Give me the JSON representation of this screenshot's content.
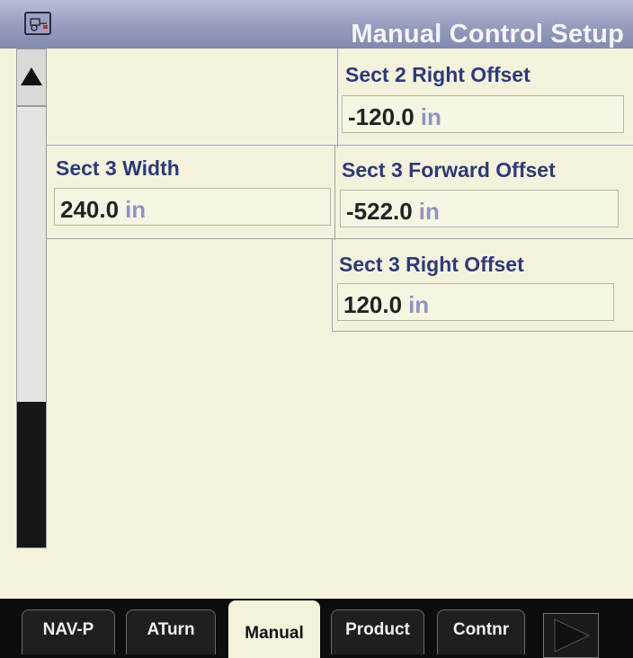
{
  "title_bar": {
    "title": "Manual Control Setup",
    "app_icon": "implement-icon"
  },
  "scrollbar": {
    "up_icon": "triangle-up-icon"
  },
  "fields": {
    "sect2_right_offset": {
      "label": "Sect 2 Right Offset",
      "value": "-120.0",
      "unit": "in"
    },
    "sect3_width": {
      "label": "Sect 3 Width",
      "value": "240.0",
      "unit": "in"
    },
    "sect3_forward_offset": {
      "label": "Sect 3 Forward Offset",
      "value": "-522.0",
      "unit": "in"
    },
    "sect3_right_offset": {
      "label": "Sect 3 Right Offset",
      "value": "120.0",
      "unit": "in"
    }
  },
  "tabs": [
    {
      "label": "NAV-P"
    },
    {
      "label": "ATurn"
    },
    {
      "label": "Manual",
      "active": true
    },
    {
      "label": "Product"
    },
    {
      "label": "Contnr"
    }
  ],
  "next_icon": "triangle-right-icon",
  "colors": {
    "title_bar": "#8f96b9",
    "background": "#f4f2dc",
    "label": "#2d3a7a",
    "unit": "#8d95c2"
  }
}
